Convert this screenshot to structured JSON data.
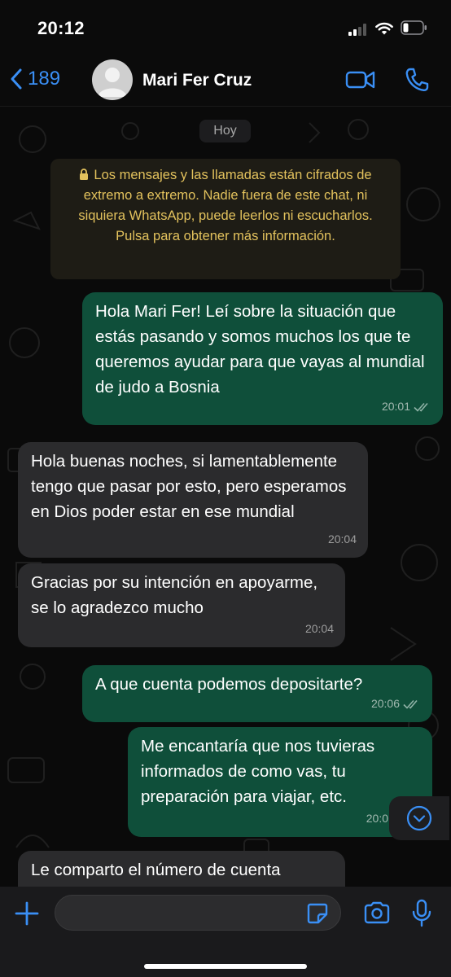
{
  "status_bar": {
    "time": "20:12"
  },
  "header": {
    "back_count": "189",
    "contact_name": "Mari Fer Cruz",
    "video_icon": "video-camera-icon",
    "call_icon": "phone-icon",
    "back_icon": "chevron-left-icon"
  },
  "chat": {
    "date_label": "Hoy",
    "encryption_notice": "Los mensajes y las llamadas están cifrados de extremo a extremo. Nadie fuera de este chat, ni siquiera WhatsApp, puede leerlos ni escucharlos. Pulsa para obtener más información.",
    "messages": [
      {
        "direction": "outgoing",
        "text": "Hola Mari Fer! Leí sobre la situación que estás pasando y somos muchos los que te queremos ayudar para que vayas al mundial de judo a Bosnia",
        "time": "20:01",
        "read": true
      },
      {
        "direction": "incoming",
        "text": "Hola buenas noches, si lamentablemente tengo que pasar por esto, pero esperamos en Dios poder estar en ese mundial",
        "time": "20:04"
      },
      {
        "direction": "incoming",
        "text": "Gracias por su intención en apoyarme, se lo agradezco mucho",
        "time": "20:04"
      },
      {
        "direction": "outgoing",
        "text": "A que cuenta podemos depositarte?",
        "time": "20:06",
        "read": true
      },
      {
        "direction": "outgoing",
        "text": "Me encantaría que nos tuvieras informados de como vas, tu preparación para viajar, etc.",
        "time": "20:0"
      },
      {
        "direction": "incoming",
        "text": "Le comparto el número de cuenta",
        "time": ""
      }
    ]
  },
  "composer": {
    "placeholder": "",
    "icons": [
      "plus-icon",
      "sticker-icon",
      "camera-icon",
      "microphone-icon"
    ]
  },
  "colors": {
    "accent": "#3a8ff5",
    "outgoing_bubble": "#0f4f3a",
    "incoming_bubble": "#2b2b2d",
    "encryption_text": "#e3c25d"
  }
}
